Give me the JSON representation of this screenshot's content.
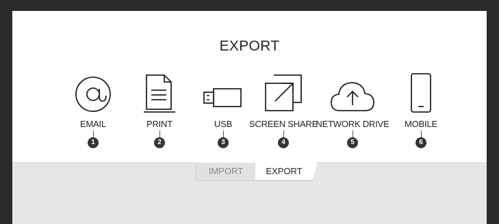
{
  "dialog": {
    "title": "EXPORT"
  },
  "options": [
    {
      "label": "EMAIL",
      "number": "1",
      "icon": "at-sign-icon"
    },
    {
      "label": "PRINT",
      "number": "2",
      "icon": "document-icon"
    },
    {
      "label": "USB",
      "number": "3",
      "icon": "usb-drive-icon"
    },
    {
      "label": "SCREEN SHARE",
      "number": "4",
      "icon": "screen-share-icon"
    },
    {
      "label": "NETWORK DRIVE",
      "number": "5",
      "icon": "cloud-upload-icon"
    },
    {
      "label": "MOBILE",
      "number": "6",
      "icon": "mobile-phone-icon"
    }
  ],
  "tabs": {
    "import_label": "IMPORT",
    "export_label": "EXPORT",
    "active": "EXPORT"
  },
  "colors": {
    "frame": "#2b2b2b",
    "panel": "#ffffff",
    "footer": "#e6e6e6",
    "badge": "#333333"
  }
}
